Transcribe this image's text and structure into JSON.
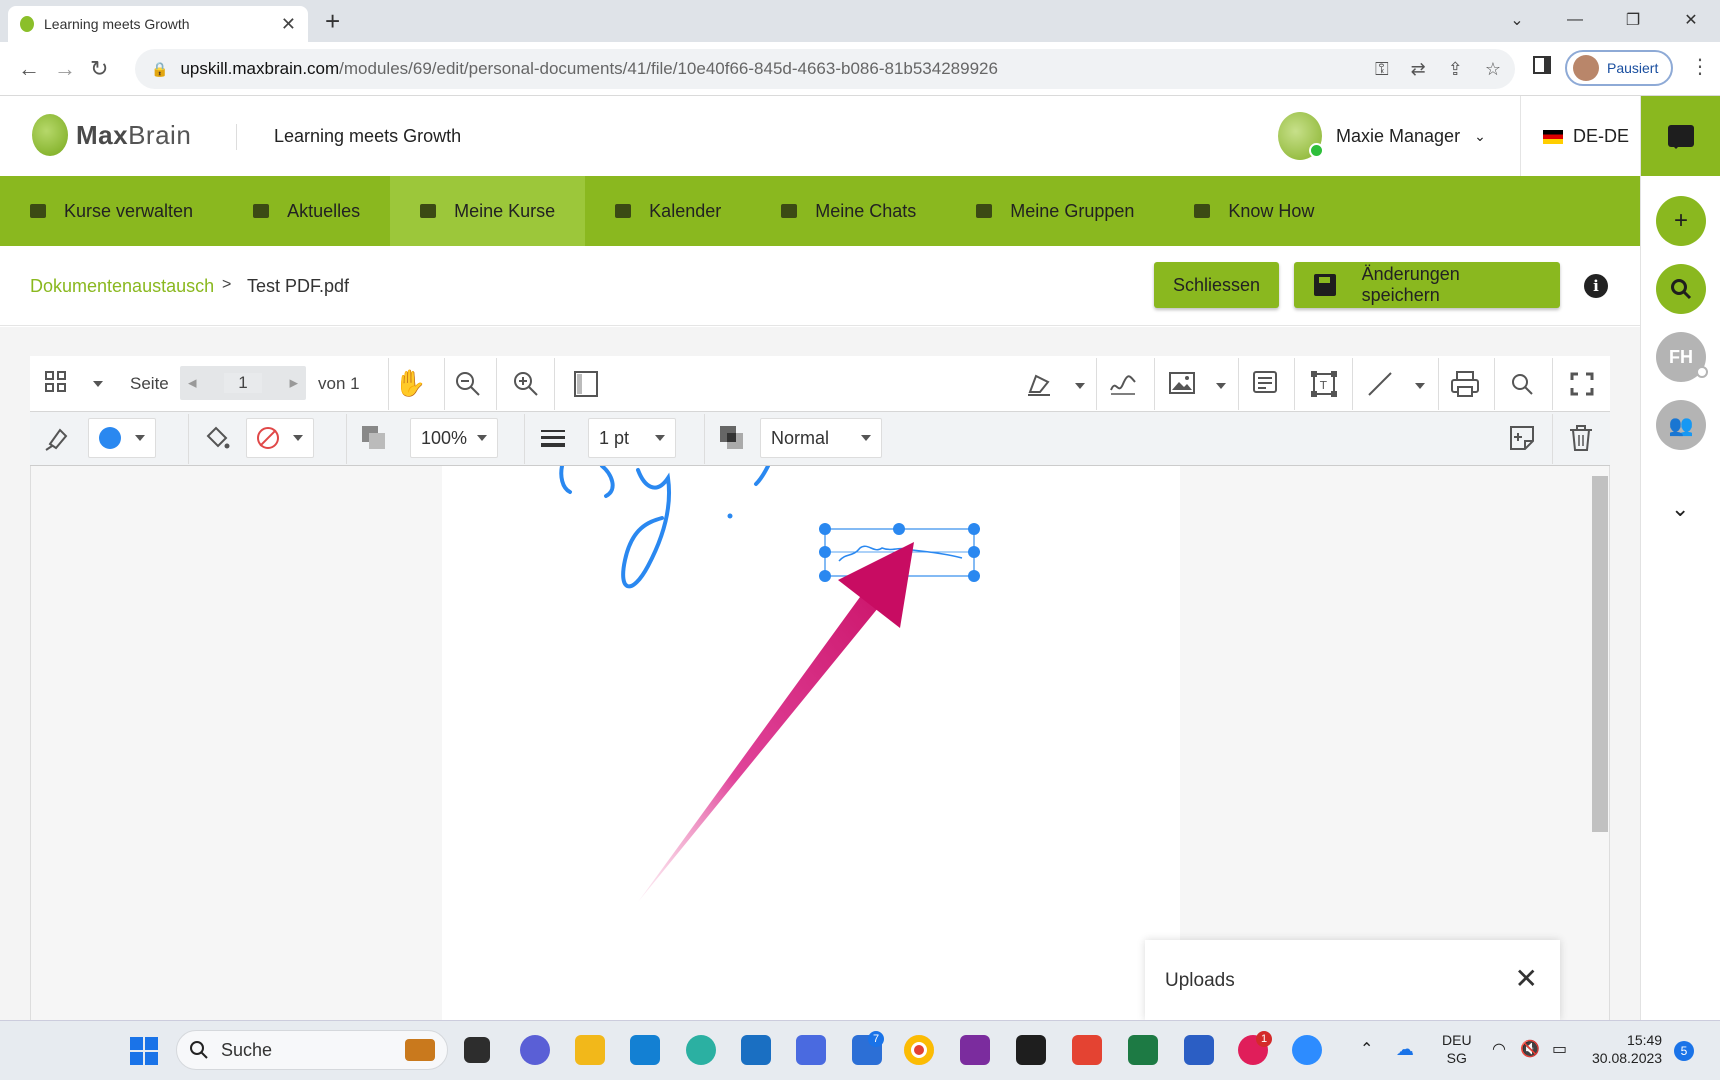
{
  "browser": {
    "tab_title": "Learning meets Growth",
    "url_host": "upskill.maxbrain.com",
    "url_path": "/modules/69/edit/personal-documents/41/file/10e40f66-845d-4663-b086-81b534289926",
    "profile_label": "Pausiert"
  },
  "header": {
    "brand_bold": "Max",
    "brand_rest": "Brain",
    "tagline": "Learning meets Growth",
    "user_name": "Maxie Manager",
    "language": "DE-DE"
  },
  "nav": {
    "items": [
      {
        "label": "Kurse verwalten"
      },
      {
        "label": "Aktuelles"
      },
      {
        "label": "Meine Kurse"
      },
      {
        "label": "Kalender"
      },
      {
        "label": "Meine Chats"
      },
      {
        "label": "Meine Gruppen"
      },
      {
        "label": "Know How"
      }
    ],
    "active_index": 2
  },
  "breadcrumb": {
    "parent": "Dokumentenaustausch",
    "separator": ">",
    "current": "Test PDF.pdf"
  },
  "actions": {
    "close_label": "Schliessen",
    "save_label": "Änderungen speichern"
  },
  "rail": {
    "avatar_initials": "FH"
  },
  "viewer": {
    "page_label": "Seite",
    "current_page": "1",
    "of_label": "von 1",
    "opacity": "100%",
    "stroke_width": "1 pt",
    "blend_mode": "Normal",
    "stroke_color": "#2a88f0"
  },
  "uploads": {
    "title": "Uploads"
  },
  "taskbar": {
    "search_placeholder": "Suche",
    "lang_top": "DEU",
    "lang_bottom": "SG",
    "time": "15:49",
    "date": "30.08.2023",
    "notification_count": "5",
    "todo_badge": "7",
    "slack_badge": "1"
  },
  "accent_colors": {
    "brand_green": "#8ab81f",
    "annotation_blue": "#2a88f0",
    "arrow_magenta": "#d0146a"
  }
}
